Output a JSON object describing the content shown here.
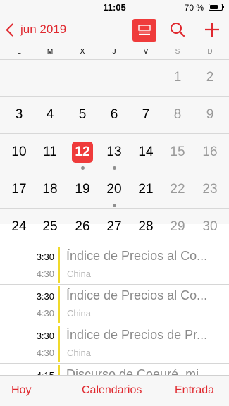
{
  "status": {
    "time": "11:05",
    "battery_pct": "70 %",
    "battery_level": 0.7
  },
  "nav": {
    "back_label": "jun 2019",
    "accent": "#e0292f",
    "list_button_bg": "#ef3b3b"
  },
  "weekdays": [
    "L",
    "M",
    "X",
    "J",
    "V",
    "S",
    "D"
  ],
  "weeks": [
    [
      "",
      "",
      "",
      "",
      "",
      "1",
      "2"
    ],
    [
      "3",
      "4",
      "5",
      "6",
      "7",
      "8",
      "9"
    ],
    [
      "10",
      "11",
      "12",
      "13",
      "14",
      "15",
      "16"
    ],
    [
      "17",
      "18",
      "19",
      "20",
      "21",
      "22",
      "23"
    ],
    [
      "24",
      "25",
      "26",
      "27",
      "28",
      "29",
      "30"
    ]
  ],
  "today": "12",
  "days_with_events": [
    "12",
    "13",
    "20"
  ],
  "events": [
    {
      "start": "3:30",
      "end": "4:30",
      "title": "Índice de Precios al Co...",
      "subtitle": "China"
    },
    {
      "start": "3:30",
      "end": "4:30",
      "title": "Índice de Precios al Co...",
      "subtitle": "China"
    },
    {
      "start": "3:30",
      "end": "4:30",
      "title": "Índice de Precios de Pr...",
      "subtitle": "China"
    },
    {
      "start": "4:15",
      "end": "",
      "title": "Discurso de Coeuré, mi...",
      "subtitle": ""
    }
  ],
  "toolbar": {
    "today_label": "Hoy",
    "calendars_label": "Calendarios",
    "inbox_label": "Entrada"
  }
}
